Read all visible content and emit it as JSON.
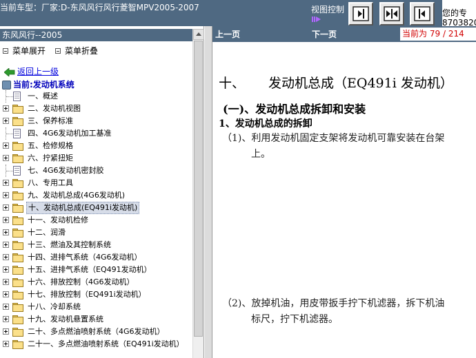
{
  "topbar": {
    "car_model": "当前车型：厂家:D-东风风行风行菱智MPV2005-2007",
    "view_control_label": "视图控制",
    "right_info_line1": "您的专",
    "right_info_line2": "8703820"
  },
  "sidebar": {
    "header": "东风风行--2005",
    "expand_menu": "菜单展开",
    "collapse_menu": "菜单折叠",
    "back_link": "返回上一级",
    "current": "当前:发动机系统",
    "tree": [
      {
        "label": "一、概述",
        "type": "doc"
      },
      {
        "label": "二、发动机视图",
        "type": "folder"
      },
      {
        "label": "三、保养标准",
        "type": "folder"
      },
      {
        "label": "四、4G6发动机加工基准",
        "type": "doc"
      },
      {
        "label": "五、检修规格",
        "type": "folder"
      },
      {
        "label": "六、拧紧扭矩",
        "type": "folder"
      },
      {
        "label": "七、4G6发动机密封胶",
        "type": "doc"
      },
      {
        "label": "八、专用工具",
        "type": "folder"
      },
      {
        "label": "九、发动机总成(4G6发动机)",
        "type": "folder"
      },
      {
        "label": "十、发动机总成(EQ491i发动机)",
        "type": "folder",
        "selected": true
      },
      {
        "label": "十一、发动机检修",
        "type": "folder"
      },
      {
        "label": "十二、润滑",
        "type": "folder"
      },
      {
        "label": "十三、燃油及其控制系统",
        "type": "folder"
      },
      {
        "label": "十四、进排气系统（4G6发动机）",
        "type": "folder"
      },
      {
        "label": "十五、进排气系统（EQ491发动机）",
        "type": "folder"
      },
      {
        "label": "十六、排放控制（4G6发动机）",
        "type": "folder"
      },
      {
        "label": "十七、排放控制（EQ491i发动机）",
        "type": "folder"
      },
      {
        "label": "十八、冷却系统",
        "type": "folder"
      },
      {
        "label": "十九、发动机悬置系统",
        "type": "folder"
      },
      {
        "label": "二十、多点燃油喷射系统（4G6发动机）",
        "type": "folder"
      },
      {
        "label": "二十一、多点燃油喷射系统（EQ491i发动机）",
        "type": "folder"
      }
    ]
  },
  "content": {
    "prev_page": "上一页",
    "next_page": "下一页",
    "page_prefix": "当前为",
    "page_current": "79",
    "page_sep": "/",
    "page_total": "214",
    "title_num": "十、",
    "title_text": "发动机总成（EQ491i 发动机）",
    "section": "(一)、发动机总成拆卸和安装",
    "subsection": "1、发动机总成的拆卸",
    "step1_line1": "（1)、利用发动机固定支架将发动机可靠安装在台架",
    "step1_line2": "上。",
    "step2_line1": "（2)、放掉机油，用皮带扳手拧下机滤器，拆下机油",
    "step2_line2": "标尺，拧下机滤器。"
  },
  "colors": {
    "bar_blue": "#4f6982",
    "page_red": "#d10000",
    "link_blue": "#0000dd"
  }
}
